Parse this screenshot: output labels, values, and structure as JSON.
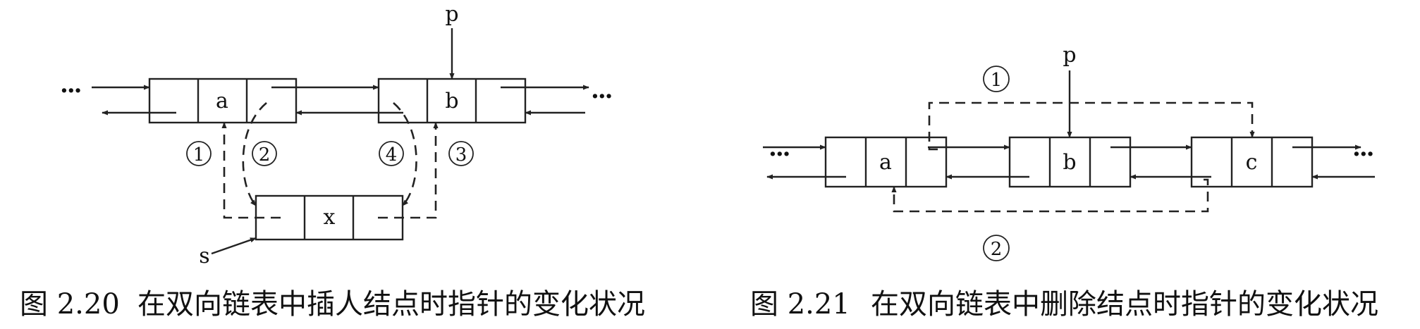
{
  "fig1": {
    "caption_num": "图 2.20",
    "caption_text": "在双向链表中插人结点时指针的变化状况",
    "node_a": "a",
    "node_b": "b",
    "node_x": "x",
    "pointer_p": "p",
    "pointer_s": "s",
    "step1": "1",
    "step2": "2",
    "step3": "3",
    "step4": "4",
    "ellipsis_left": "···",
    "ellipsis_right": "···"
  },
  "fig2": {
    "caption_num": "图 2.21",
    "caption_text": "在双向链表中删除结点时指针的变化状况",
    "node_a": "a",
    "node_b": "b",
    "node_c": "c",
    "pointer_p": "p",
    "step1": "1",
    "step2": "2",
    "ellipsis_left": "···",
    "ellipsis_right": "···"
  }
}
